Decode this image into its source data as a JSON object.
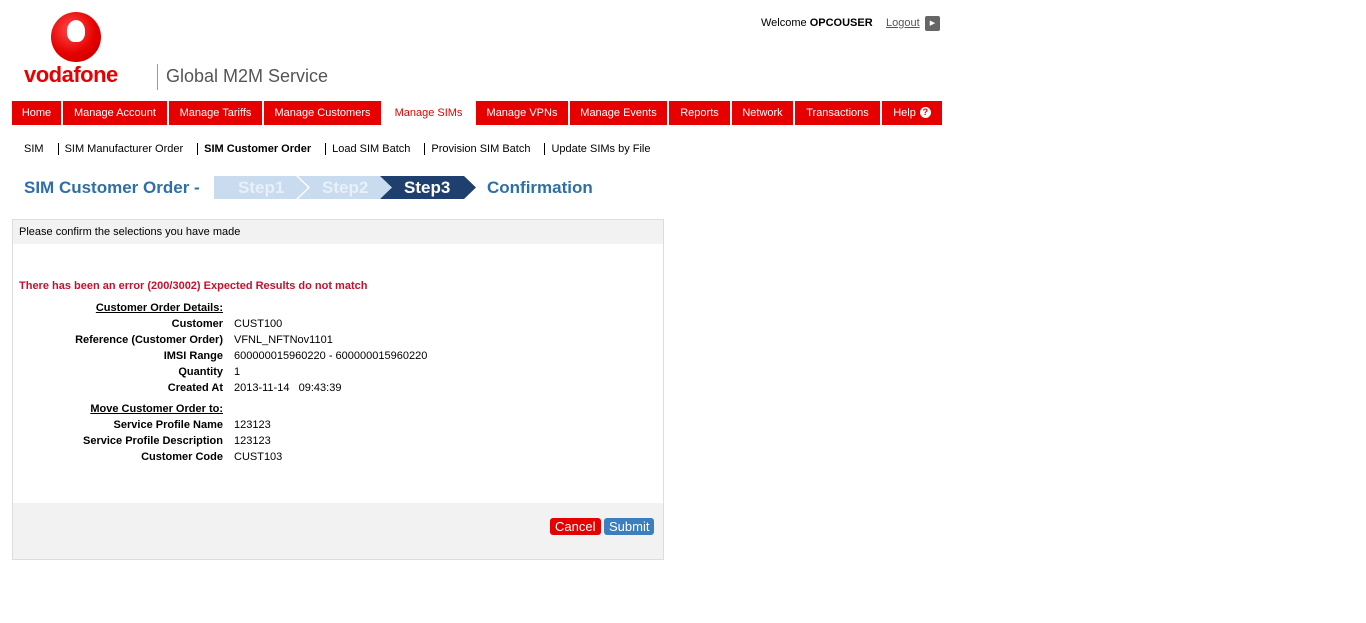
{
  "brand": {
    "logo_text": "vodafone",
    "service": "Global M2M Service"
  },
  "user": {
    "welcome": "Welcome",
    "name": "OPCOUSER",
    "logout": "Logout"
  },
  "nav": [
    {
      "label": "Home",
      "active": false
    },
    {
      "label": "Manage Account",
      "active": false
    },
    {
      "label": "Manage Tariffs",
      "active": false
    },
    {
      "label": "Manage Customers",
      "active": false
    },
    {
      "label": "Manage SIMs",
      "active": true
    },
    {
      "label": "Manage VPNs",
      "active": false
    },
    {
      "label": "Manage Events",
      "active": false
    },
    {
      "label": "Reports",
      "active": false
    },
    {
      "label": "Network",
      "active": false
    },
    {
      "label": "Transactions",
      "active": false
    },
    {
      "label": "Help",
      "active": false
    }
  ],
  "subnav": [
    {
      "label": "SIM",
      "active": false
    },
    {
      "label": "SIM Manufacturer Order",
      "active": false
    },
    {
      "label": "SIM Customer Order",
      "active": true
    },
    {
      "label": "Load SIM Batch",
      "active": false
    },
    {
      "label": "Provision SIM Batch",
      "active": false
    },
    {
      "label": "Update SIMs by File",
      "active": false
    }
  ],
  "page": {
    "title": "SIM Customer Order -",
    "steps": [
      "Step1",
      "Step2",
      "Step3"
    ],
    "current_step": 3,
    "confirmation": "Confirmation"
  },
  "panel": {
    "header": "Please confirm the selections you have made",
    "error": "There has been an error (200/3002) Expected Results do not match",
    "order_section": "Customer Order Details:",
    "order_rows": [
      {
        "label": "Customer",
        "value": "CUST100"
      },
      {
        "label": "Reference (Customer Order)",
        "value": "VFNL_NFTNov1101"
      },
      {
        "label": "IMSI Range",
        "value": "600000015960220 - 600000015960220"
      },
      {
        "label": "Quantity",
        "value": "1"
      },
      {
        "label": "Created At",
        "value": "2013-11-14   09:43:39"
      }
    ],
    "move_section": "Move Customer Order to:",
    "move_rows": [
      {
        "label": "Service Profile Name",
        "value": "123123"
      },
      {
        "label": "Service Profile Description",
        "value": "123123"
      },
      {
        "label": "Customer Code",
        "value": "CUST103"
      }
    ],
    "cancel": "Cancel",
    "submit": "Submit"
  },
  "colors": {
    "brand_red": "#e60000",
    "title_blue": "#2f6fa8",
    "step_active": "#1f3f6e",
    "step_inactive": "#c9dbee",
    "error_red": "#c8102e",
    "submit_blue": "#3b7fc0"
  }
}
